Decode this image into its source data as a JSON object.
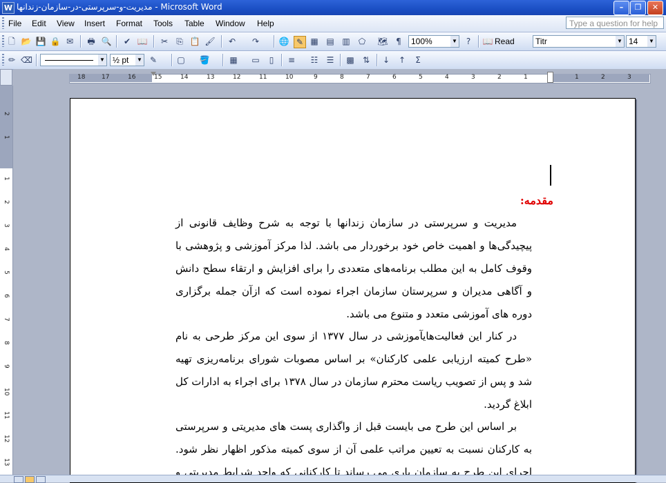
{
  "window": {
    "title": "مدیریت-و-سرپرستی-در-سازمان-زندانها - Microsoft Word"
  },
  "menubar": {
    "items": [
      {
        "label": "File"
      },
      {
        "label": "Edit"
      },
      {
        "label": "View"
      },
      {
        "label": "Insert"
      },
      {
        "label": "Format"
      },
      {
        "label": "Tools"
      },
      {
        "label": "Table"
      },
      {
        "label": "Window"
      },
      {
        "label": "Help"
      }
    ],
    "ask_placeholder": "Type a question for help"
  },
  "standard_toolbar": {
    "zoom": "100%",
    "read_label": "Read",
    "font_name": "Titr",
    "font_size": "14"
  },
  "tables_toolbar": {
    "line_weight": "½ pt"
  },
  "ruler": {
    "numbers": [
      "18",
      "17",
      "16",
      "15",
      "14",
      "13",
      "12",
      "11",
      "10",
      "9",
      "8",
      "7",
      "6",
      "5",
      "4",
      "3",
      "2",
      "1",
      "1",
      "2",
      "3"
    ]
  },
  "vruler": {
    "numbers": [
      "2",
      "1",
      "1",
      "2",
      "3",
      "4",
      "5",
      "6",
      "7",
      "8",
      "9",
      "10",
      "11",
      "12",
      "13"
    ]
  },
  "document": {
    "heading": "مقدمه:",
    "paragraphs": [
      "مدیریت و سرپرستی در سازمان زندانها با توجه به  شرح وظایف قانونی از پیچیدگی‌ها و اهمیت خاص خود برخوردار می باشد. لذا مرکز آموزشی و پژوهشی با وقوف کامل به این مطلب برنامه‌های متعددی را برای افزایش و ارتقاء سطح دانش و آگاهی مدیران و سرپرستان سازمان اجراء نموده است که ازآن جمله برگزاری دوره های آموزشی متعدد و متنوع می باشد.",
      "در کنار این فعالیت‌هایآموزشی در سال ۱۳۷۷ از سوی این مرکز طرحی به نام «طرح کمیته ارزیابی علمی کارکنان» بر اساس مصوبات شورای برنامه‌ریزی تهیه شد و پس از تصویب ریاست محترم سازمان در سال ۱۳۷۸ برای اجراء به ادارات کل ابلاغ گردید.",
      "بر اساس این طرح می بایست قبل از واگذاری پست های مدیریتی و سرپرستی به کارکنان نسبت به تعیین مراتب علمی آن از سوی کمیته مذکور اظهار نظر شود. اجرای این طرح به سازمان یاری می رساند تا کارکنانی که واجد شرایط مدیریتی و سرپرستی"
    ]
  }
}
